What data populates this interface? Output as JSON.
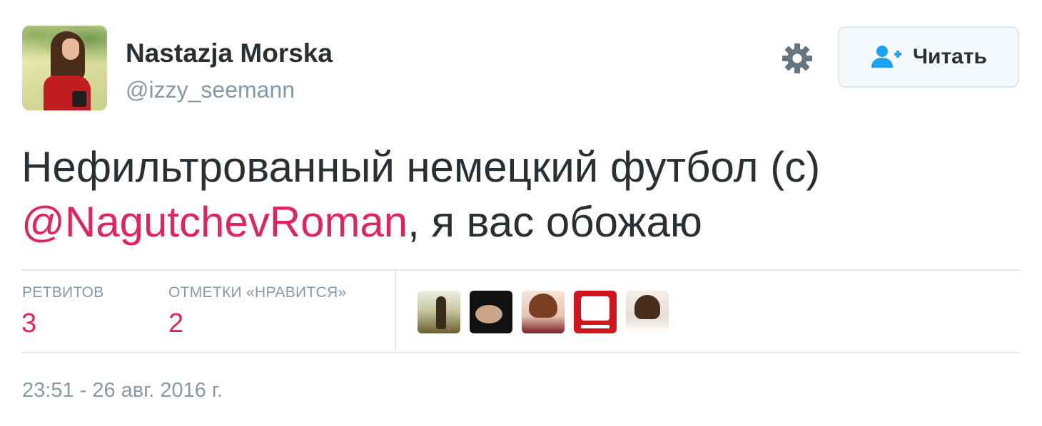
{
  "user": {
    "name": "Nastazja Morska",
    "handle": "@izzy_seemann"
  },
  "follow_button": {
    "label": "Читать",
    "icon": "add-person-icon"
  },
  "settings": {
    "icon": "gear-icon"
  },
  "tweet": {
    "text_line1": "Нефильтрованный немецкий футбол (с)",
    "mention": "@NagutchevRoman",
    "text_after_mention": ", я вас обожаю"
  },
  "stats": {
    "retweets_label": "РЕТВИТОВ",
    "retweets_count": "3",
    "likes_label": "ОТМЕТКИ «НРАВИТСЯ»",
    "likes_count": "2"
  },
  "likers": [
    {
      "name": "liker-avatar"
    },
    {
      "name": "liker-avatar"
    },
    {
      "name": "liker-avatar"
    },
    {
      "name": "liker-avatar"
    },
    {
      "name": "liker-avatar"
    }
  ],
  "timestamp": "23:51 - 26 авг. 2016 г.",
  "colors": {
    "accent": "#e0245e",
    "text": "#292f33",
    "muted": "#8899a6",
    "follow_icon": "#1da1f2",
    "border": "#e1e8ed"
  }
}
